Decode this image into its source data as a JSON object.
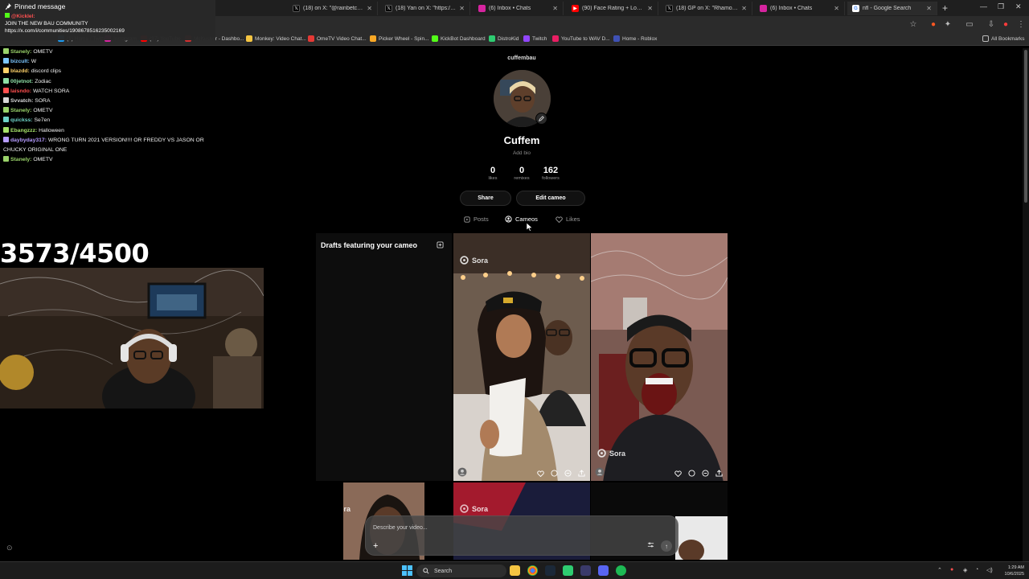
{
  "browser": {
    "tabs": [
      {
        "title": "(18) on X: \"@rainbetcom",
        "favicon": "x",
        "color": "#000000"
      },
      {
        "title": "(18) Yan on X: \"https://t.co/Yz",
        "favicon": "x",
        "color": "#000000"
      },
      {
        "title": "(6) Inbox • Chats",
        "favicon": "instagram",
        "color": "#d6249f"
      },
      {
        "title": "(90) Face Rating + Looksmax",
        "favicon": "youtube",
        "color": "#ff0000"
      },
      {
        "title": "(18) GP on X: \"Rhamondre",
        "favicon": "x",
        "color": "#000000"
      },
      {
        "title": "(6) Inbox • Chats",
        "favicon": "instagram",
        "color": "#d6249f"
      },
      {
        "title": "nfl - Google Search",
        "favicon": "google",
        "color": "#4285f4"
      }
    ],
    "bookmarks": [
      {
        "label": "(1) Home / Twitter",
        "color": "#1d9bf0"
      },
      {
        "label": "Instagram",
        "color": "#d6249f"
      },
      {
        "label": "(37) YouTube",
        "color": "#ff0000"
      },
      {
        "label": "McKusker - Dashbo...",
        "color": "#d32f2f"
      },
      {
        "label": "Monkey: Video Chat...",
        "color": "#f5c542"
      },
      {
        "label": "OmeTV Video Chat...",
        "color": "#e53935"
      },
      {
        "label": "Picker Wheel - Spin...",
        "color": "#f9a825"
      },
      {
        "label": "KickBot Dashboard",
        "color": "#53fc18"
      },
      {
        "label": "DistroKid",
        "color": "#2ecc71"
      },
      {
        "label": "Twitch",
        "color": "#9146ff"
      },
      {
        "label": "YouTube to WAV D...",
        "color": "#e91e63"
      },
      {
        "label": "Home - Roblox",
        "color": "#3f51b5"
      }
    ],
    "all_bookmarks": "All Bookmarks"
  },
  "stream": {
    "pinned": {
      "header": "Pinned message",
      "user": "@Kicklel:",
      "line1": "JOIN THE NEW BAU COMMUNITY",
      "line2": "https://x.com/i/communities/1908678516235002169"
    },
    "chat": [
      {
        "user": "Stanely:",
        "text": "OMETV",
        "color": "#9ad36a"
      },
      {
        "user": "bizcult:",
        "text": "W",
        "color": "#7cc7ff"
      },
      {
        "user": "blazdd:",
        "text": "discord clips",
        "color": "#ffd36a"
      },
      {
        "user": "00jetnot:",
        "text": "Zodiac",
        "color": "#8de0a6"
      },
      {
        "user": "laisndo:",
        "text": "WATCH SORA",
        "color": "#ff4f4f"
      },
      {
        "user": "Svvatch:",
        "text": "SORA",
        "color": "#d7d7d7"
      },
      {
        "user": "Stanely:",
        "text": "OMETV",
        "color": "#9ad36a"
      },
      {
        "user": "quickss:",
        "text": "Se7en",
        "color": "#6ed3c8"
      },
      {
        "user": "Ebangzzz:",
        "text": "Halloween",
        "color": "#a7e36a"
      },
      {
        "user": "daybyday317:",
        "text": "WRONG TURN 2021 VERSION!!!! OR FREDDY VS JASON OR CHUCKY ORIGINAL ONE",
        "color": "#b69cff"
      },
      {
        "user": "Stanely:",
        "text": "OMETV",
        "color": "#9ad36a"
      }
    ],
    "counter": "3573/4500"
  },
  "profile": {
    "handle": "cuffembau",
    "display_name": "Cuffem",
    "bio_placeholder": "Add bio",
    "stats": [
      {
        "value": "0",
        "label": "likes"
      },
      {
        "value": "0",
        "label": "remixes"
      },
      {
        "value": "162",
        "label": "followers"
      }
    ],
    "share_label": "Share",
    "edit_label": "Edit cameo",
    "tabs": [
      {
        "label": "Posts",
        "icon": "posts-icon",
        "active": false
      },
      {
        "label": "Cameos",
        "icon": "cameos-icon",
        "active": true
      },
      {
        "label": "Likes",
        "icon": "heart-icon",
        "active": false
      }
    ],
    "drafts_title": "Drafts featuring your cameo",
    "watermark": "Sora",
    "composer_placeholder": "Describe your video..."
  },
  "taskbar": {
    "search_label": "Search",
    "time": "1:29 AM",
    "date": "10/6/2025"
  }
}
